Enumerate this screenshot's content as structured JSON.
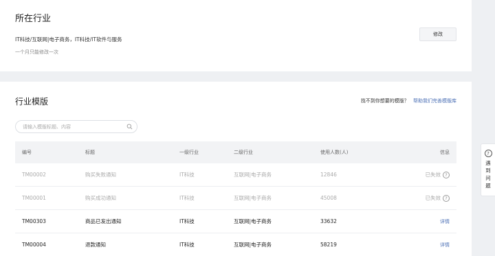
{
  "industry": {
    "title": "所在行业",
    "value": "IT科技/互联网|电子商务，IT科技/IT软件与服务",
    "note": "一个月只能修改一次",
    "modify_label": "修改"
  },
  "templates": {
    "title": "行业模版",
    "help_question": "找不到你想要的模版？",
    "help_link": "帮助我们完善模版库",
    "search_placeholder": "请输入模版标题、内容",
    "columns": [
      "编号",
      "标题",
      "一级行业",
      "二级行业",
      "使用人数(人)",
      "信息"
    ],
    "rows": [
      {
        "code": "TM00002",
        "title": "购买失败通知",
        "l1": "IT科技",
        "l2": "互联网|电子商务",
        "users": "12846",
        "info": "已失效",
        "state": "disabled"
      },
      {
        "code": "TM00001",
        "title": "购买成功通知",
        "l1": "IT科技",
        "l2": "互联网|电子商务",
        "users": "45008",
        "info": "已失效",
        "state": "disabled"
      },
      {
        "code": "TM00303",
        "title": "商品已发出通知",
        "l1": "IT科技",
        "l2": "互联网|电子商务",
        "users": "33632",
        "info": "详情",
        "state": "active"
      },
      {
        "code": "TM00004",
        "title": "退款通知",
        "l1": "IT科技",
        "l2": "互联网|电子商务",
        "users": "58219",
        "info": "详情",
        "state": "active"
      }
    ]
  },
  "help_float": {
    "icon_glyph": "?",
    "text": "遇到问题"
  },
  "lost_icon_glyph": "?"
}
